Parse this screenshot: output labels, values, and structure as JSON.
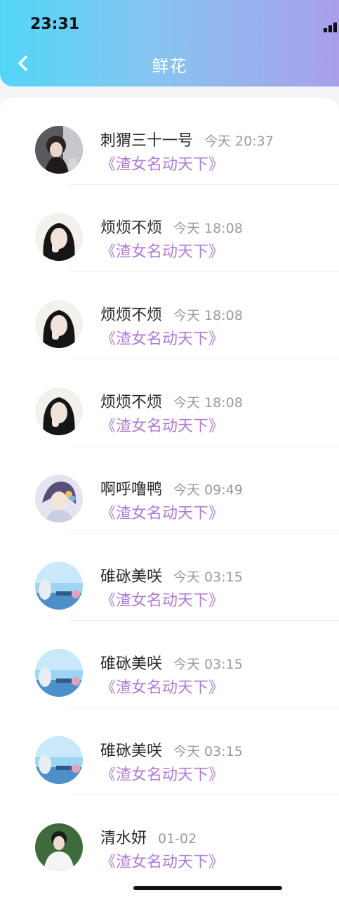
{
  "status": {
    "time": "23:31"
  },
  "header": {
    "title": "鲜花"
  },
  "icons": {
    "back": "chevron-left-icon",
    "signal": "signal-icon"
  },
  "colors": {
    "gradient_start": "#52d6f8",
    "gradient_end": "#a99eea",
    "book_title": "#b07ad6"
  },
  "list": [
    {
      "name": "刺猬三十一号",
      "time": "今天 20:37",
      "book": "《渣女名动天下》",
      "avatar": "dark-hair-girl"
    },
    {
      "name": "烦烦不烦",
      "time": "今天 18:08",
      "book": "《渣女名动天下》",
      "avatar": "girl-hand-face"
    },
    {
      "name": "烦烦不烦",
      "time": "今天 18:08",
      "book": "《渣女名动天下》",
      "avatar": "girl-hand-face"
    },
    {
      "name": "烦烦不烦",
      "time": "今天 18:08",
      "book": "《渣女名动天下》",
      "avatar": "girl-hand-face"
    },
    {
      "name": "啊呼噜鸭",
      "time": "今天 09:49",
      "book": "《渣女名动天下》",
      "avatar": "anime-boy"
    },
    {
      "name": "碓砯美咲",
      "time": "今天 03:15",
      "book": "《渣女名动天下》",
      "avatar": "sky-scene"
    },
    {
      "name": "碓砯美咲",
      "time": "今天 03:15",
      "book": "《渣女名动天下》",
      "avatar": "sky-scene"
    },
    {
      "name": "碓砯美咲",
      "time": "今天 03:15",
      "book": "《渣女名动天下》",
      "avatar": "sky-scene"
    },
    {
      "name": "清水妍",
      "time": "01-02",
      "book": "《渣女名动天下》",
      "avatar": "man-green-bg"
    }
  ]
}
